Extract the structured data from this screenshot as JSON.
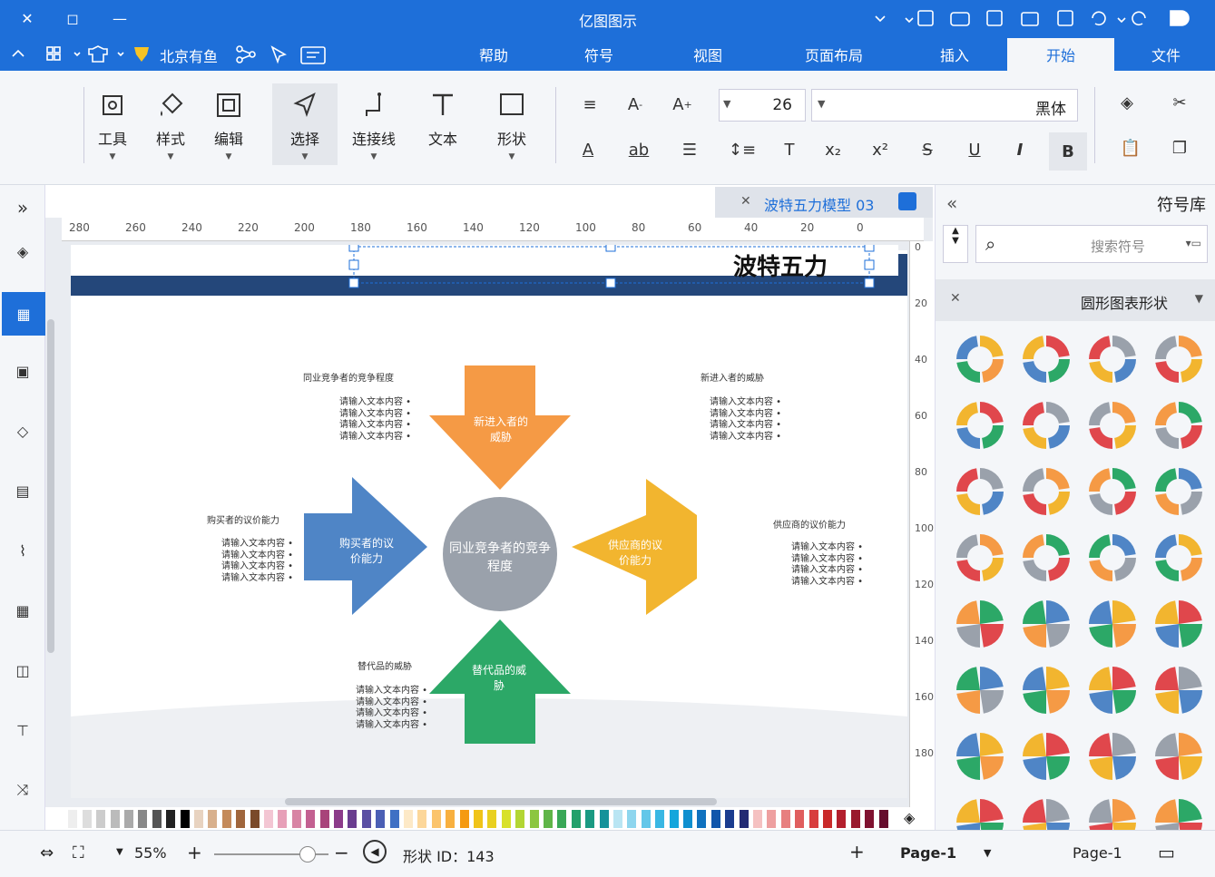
{
  "window": {
    "title": "亿图图示",
    "close_label": "✕",
    "restore_label": "◻",
    "minimize_label": "—"
  },
  "menu": {
    "tabs": [
      "文件",
      "开始",
      "插入",
      "页面布局",
      "视图",
      "符号",
      "帮助"
    ],
    "active_tab": "开始",
    "left_group": "北京有鱼"
  },
  "ribbon": {
    "font_name": "黑体",
    "font_size": "26",
    "tools": [
      "形状",
      "文本",
      "连接线",
      "选择",
      "编辑",
      "样式",
      "工具"
    ]
  },
  "document": {
    "tab_title": "波特五力模型 03",
    "ruler_labels": [
      "0",
      "20",
      "40",
      "60",
      "80",
      "100",
      "120",
      "140",
      "160",
      "180",
      "200",
      "220",
      "240",
      "260",
      "280"
    ],
    "vruler_labels": [
      "0",
      "20",
      "40",
      "60",
      "80",
      "100",
      "120",
      "140",
      "160",
      "180"
    ]
  },
  "diagram": {
    "title": "波特五力",
    "center": "同业竞争者的竞争程度",
    "top_arrow": "新进入者的威胁",
    "left_arrow": "供应商的议价能力",
    "right_arrow": "购买者的议价能力",
    "bottom_arrow": "替代品的威胁",
    "heading_top_right": "同业竞争者的竞争程度",
    "heading_top_left": "新进入者的威胁",
    "heading_mid_right": "购买者的议价能力",
    "heading_mid_left": "供应商的议价能力",
    "heading_bottom_right": "替代品的威胁",
    "bullet": "请输入文本内容",
    "colors": {
      "top": "#f59a45",
      "left": "#f2b52f",
      "right": "#4f85c6",
      "bottom": "#2ca867",
      "center": "#9aa1ab",
      "banner": "#24477a"
    }
  },
  "right_panel": {
    "title": "符号库",
    "search_placeholder": "搜索符号",
    "category": "圆形图表形状"
  },
  "status": {
    "page_label": "Page-1",
    "page_tab": "Page-1",
    "shape_id": "形状 ID：143",
    "zoom": "55%"
  }
}
